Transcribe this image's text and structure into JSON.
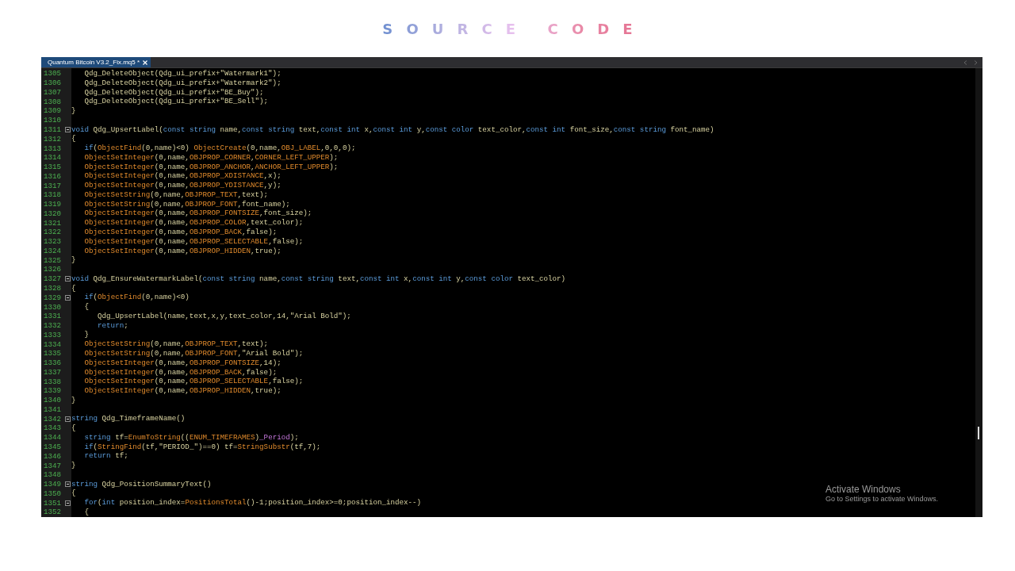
{
  "page_title": "SOURCE CODE",
  "editor": {
    "tabs": [
      {
        "label": "Quantum Bitcoin V3.2_Fix.mq5 *",
        "selected": true
      }
    ],
    "lines": [
      {
        "number": "1305",
        "foldable": false,
        "tokens": [
          {
            "kind": "plain",
            "text": "   Qdg_DeleteObject(Qdg_ui_prefix+\"Watermark1\");"
          }
        ]
      },
      {
        "number": "1306",
        "foldable": false,
        "tokens": [
          {
            "kind": "plain",
            "text": "   Qdg_DeleteObject(Qdg_ui_prefix+\"Watermark2\");"
          }
        ]
      },
      {
        "number": "1307",
        "foldable": false,
        "tokens": [
          {
            "kind": "plain",
            "text": "   Qdg_DeleteObject(Qdg_ui_prefix+\"BE_Buy\");"
          }
        ]
      },
      {
        "number": "1308",
        "foldable": false,
        "tokens": [
          {
            "kind": "plain",
            "text": "   Qdg_DeleteObject(Qdg_ui_prefix+\"BE_Sell\");"
          }
        ]
      },
      {
        "number": "1309",
        "foldable": false,
        "tokens": [
          {
            "kind": "plain",
            "text": "}"
          }
        ]
      },
      {
        "number": "1310",
        "foldable": false
      },
      {
        "number": "1311",
        "foldable": true,
        "tokens": [
          {
            "kind": "kw",
            "text": "void"
          },
          {
            "kind": "plain",
            "text": " Qdg_UpsertLabel("
          },
          {
            "kind": "kw",
            "text": "const string"
          },
          {
            "kind": "plain",
            "text": " name,"
          },
          {
            "kind": "kw",
            "text": "const string"
          },
          {
            "kind": "plain",
            "text": " text,"
          },
          {
            "kind": "kw",
            "text": "const int"
          },
          {
            "kind": "plain",
            "text": " x,"
          },
          {
            "kind": "kw",
            "text": "const int"
          },
          {
            "kind": "plain",
            "text": " y,"
          },
          {
            "kind": "kw",
            "text": "const color"
          },
          {
            "kind": "plain",
            "text": " text_color,"
          },
          {
            "kind": "kw",
            "text": "const int"
          },
          {
            "kind": "plain",
            "text": " font_size,"
          },
          {
            "kind": "kw",
            "text": "const string"
          },
          {
            "kind": "plain",
            "text": " font_name)"
          }
        ]
      },
      {
        "number": "1312",
        "foldable": false,
        "tokens": [
          {
            "kind": "plain",
            "text": "{"
          }
        ]
      },
      {
        "number": "1313",
        "foldable": false,
        "tokens": [
          {
            "kind": "kw",
            "text": "   if"
          },
          {
            "kind": "plain",
            "text": "("
          },
          {
            "kind": "fn",
            "text": "ObjectFind"
          },
          {
            "kind": "plain",
            "text": "(0,name)<0) "
          },
          {
            "kind": "fn",
            "text": "ObjectCreate"
          },
          {
            "kind": "plain",
            "text": "(0,name,"
          },
          {
            "kind": "fn",
            "text": "OBJ_LABEL"
          },
          {
            "kind": "plain",
            "text": ",0,0,0);"
          }
        ]
      },
      {
        "number": "1314",
        "foldable": false,
        "tokens": [
          {
            "kind": "fn",
            "text": "   ObjectSetInteger"
          },
          {
            "kind": "plain",
            "text": "(0,name,"
          },
          {
            "kind": "fn",
            "text": "OBJPROP_CORNER"
          },
          {
            "kind": "plain",
            "text": ","
          },
          {
            "kind": "fn",
            "text": "CORNER_LEFT_UPPER"
          },
          {
            "kind": "plain",
            "text": ");"
          }
        ]
      },
      {
        "number": "1315",
        "foldable": false,
        "tokens": [
          {
            "kind": "fn",
            "text": "   ObjectSetInteger"
          },
          {
            "kind": "plain",
            "text": "(0,name,"
          },
          {
            "kind": "fn",
            "text": "OBJPROP_ANCHOR"
          },
          {
            "kind": "plain",
            "text": ","
          },
          {
            "kind": "fn",
            "text": "ANCHOR_LEFT_UPPER"
          },
          {
            "kind": "plain",
            "text": ");"
          }
        ]
      },
      {
        "number": "1316",
        "foldable": false,
        "tokens": [
          {
            "kind": "fn",
            "text": "   ObjectSetInteger"
          },
          {
            "kind": "plain",
            "text": "(0,name,"
          },
          {
            "kind": "fn",
            "text": "OBJPROP_XDISTANCE"
          },
          {
            "kind": "plain",
            "text": ",x);"
          }
        ]
      },
      {
        "number": "1317",
        "foldable": false,
        "tokens": [
          {
            "kind": "fn",
            "text": "   ObjectSetInteger"
          },
          {
            "kind": "plain",
            "text": "(0,name,"
          },
          {
            "kind": "fn",
            "text": "OBJPROP_YDISTANCE"
          },
          {
            "kind": "plain",
            "text": ",y);"
          }
        ]
      },
      {
        "number": "1318",
        "foldable": false,
        "tokens": [
          {
            "kind": "fn",
            "text": "   ObjectSetString"
          },
          {
            "kind": "plain",
            "text": "(0,name,"
          },
          {
            "kind": "fn",
            "text": "OBJPROP_TEXT"
          },
          {
            "kind": "plain",
            "text": ",text);"
          }
        ]
      },
      {
        "number": "1319",
        "foldable": false,
        "tokens": [
          {
            "kind": "fn",
            "text": "   ObjectSetString"
          },
          {
            "kind": "plain",
            "text": "(0,name,"
          },
          {
            "kind": "fn",
            "text": "OBJPROP_FONT"
          },
          {
            "kind": "plain",
            "text": ",font_name);"
          }
        ]
      },
      {
        "number": "1320",
        "foldable": false,
        "tokens": [
          {
            "kind": "fn",
            "text": "   ObjectSetInteger"
          },
          {
            "kind": "plain",
            "text": "(0,name,"
          },
          {
            "kind": "fn",
            "text": "OBJPROP_FONTSIZE"
          },
          {
            "kind": "plain",
            "text": ",font_size);"
          }
        ]
      },
      {
        "number": "1321",
        "foldable": false,
        "tokens": [
          {
            "kind": "fn",
            "text": "   ObjectSetInteger"
          },
          {
            "kind": "plain",
            "text": "(0,name,"
          },
          {
            "kind": "fn",
            "text": "OBJPROP_COLOR"
          },
          {
            "kind": "plain",
            "text": ",text_color);"
          }
        ]
      },
      {
        "number": "1322",
        "foldable": false,
        "tokens": [
          {
            "kind": "fn",
            "text": "   ObjectSetInteger"
          },
          {
            "kind": "plain",
            "text": "(0,name,"
          },
          {
            "kind": "fn",
            "text": "OBJPROP_BACK"
          },
          {
            "kind": "plain",
            "text": ",false);"
          }
        ]
      },
      {
        "number": "1323",
        "foldable": false,
        "tokens": [
          {
            "kind": "fn",
            "text": "   ObjectSetInteger"
          },
          {
            "kind": "plain",
            "text": "(0,name,"
          },
          {
            "kind": "fn",
            "text": "OBJPROP_SELECTABLE"
          },
          {
            "kind": "plain",
            "text": ",false);"
          }
        ]
      },
      {
        "number": "1324",
        "foldable": false,
        "tokens": [
          {
            "kind": "fn",
            "text": "   ObjectSetInteger"
          },
          {
            "kind": "plain",
            "text": "(0,name,"
          },
          {
            "kind": "fn",
            "text": "OBJPROP_HIDDEN"
          },
          {
            "kind": "plain",
            "text": ",true);"
          }
        ]
      },
      {
        "number": "1325",
        "foldable": false,
        "tokens": [
          {
            "kind": "plain",
            "text": "}"
          }
        ]
      },
      {
        "number": "1326",
        "foldable": false
      },
      {
        "number": "1327",
        "foldable": true,
        "tokens": [
          {
            "kind": "kw",
            "text": "void"
          },
          {
            "kind": "plain",
            "text": " Qdg_EnsureWatermarkLabel("
          },
          {
            "kind": "kw",
            "text": "const string"
          },
          {
            "kind": "plain",
            "text": " name,"
          },
          {
            "kind": "kw",
            "text": "const string"
          },
          {
            "kind": "plain",
            "text": " text,"
          },
          {
            "kind": "kw",
            "text": "const int"
          },
          {
            "kind": "plain",
            "text": " x,"
          },
          {
            "kind": "kw",
            "text": "const int"
          },
          {
            "kind": "plain",
            "text": " y,"
          },
          {
            "kind": "kw",
            "text": "const color"
          },
          {
            "kind": "plain",
            "text": " text_color)"
          }
        ]
      },
      {
        "number": "1328",
        "foldable": false,
        "tokens": [
          {
            "kind": "plain",
            "text": "{"
          }
        ]
      },
      {
        "number": "1329",
        "foldable": true,
        "tokens": [
          {
            "kind": "kw",
            "text": "   if"
          },
          {
            "kind": "plain",
            "text": "("
          },
          {
            "kind": "fn",
            "text": "ObjectFind"
          },
          {
            "kind": "plain",
            "text": "(0,name)<0)"
          }
        ]
      },
      {
        "number": "1330",
        "foldable": false,
        "tokens": [
          {
            "kind": "plain",
            "text": "   {"
          }
        ]
      },
      {
        "number": "1331",
        "foldable": false,
        "tokens": [
          {
            "kind": "plain",
            "text": "      Qdg_UpsertLabel(name,text,x,y,text_color,14,\"Arial Bold\");"
          }
        ]
      },
      {
        "number": "1332",
        "foldable": false,
        "tokens": [
          {
            "kind": "kw",
            "text": "      return"
          },
          {
            "kind": "plain",
            "text": ";"
          }
        ]
      },
      {
        "number": "1333",
        "foldable": false,
        "tokens": [
          {
            "kind": "plain",
            "text": "   }"
          }
        ]
      },
      {
        "number": "1334",
        "foldable": false,
        "tokens": [
          {
            "kind": "fn",
            "text": "   ObjectSetString"
          },
          {
            "kind": "plain",
            "text": "(0,name,"
          },
          {
            "kind": "fn",
            "text": "OBJPROP_TEXT"
          },
          {
            "kind": "plain",
            "text": ",text);"
          }
        ]
      },
      {
        "number": "1335",
        "foldable": false,
        "tokens": [
          {
            "kind": "fn",
            "text": "   ObjectSetString"
          },
          {
            "kind": "plain",
            "text": "(0,name,"
          },
          {
            "kind": "fn",
            "text": "OBJPROP_FONT"
          },
          {
            "kind": "plain",
            "text": ",\"Arial Bold\");"
          }
        ]
      },
      {
        "number": "1336",
        "foldable": false,
        "tokens": [
          {
            "kind": "fn",
            "text": "   ObjectSetInteger"
          },
          {
            "kind": "plain",
            "text": "(0,name,"
          },
          {
            "kind": "fn",
            "text": "OBJPROP_FONTSIZE"
          },
          {
            "kind": "plain",
            "text": ",14);"
          }
        ]
      },
      {
        "number": "1337",
        "foldable": false,
        "tokens": [
          {
            "kind": "fn",
            "text": "   ObjectSetInteger"
          },
          {
            "kind": "plain",
            "text": "(0,name,"
          },
          {
            "kind": "fn",
            "text": "OBJPROP_BACK"
          },
          {
            "kind": "plain",
            "text": ",false);"
          }
        ]
      },
      {
        "number": "1338",
        "foldable": false,
        "tokens": [
          {
            "kind": "fn",
            "text": "   ObjectSetInteger"
          },
          {
            "kind": "plain",
            "text": "(0,name,"
          },
          {
            "kind": "fn",
            "text": "OBJPROP_SELECTABLE"
          },
          {
            "kind": "plain",
            "text": ",false);"
          }
        ]
      },
      {
        "number": "1339",
        "foldable": false,
        "tokens": [
          {
            "kind": "fn",
            "text": "   ObjectSetInteger"
          },
          {
            "kind": "plain",
            "text": "(0,name,"
          },
          {
            "kind": "fn",
            "text": "OBJPROP_HIDDEN"
          },
          {
            "kind": "plain",
            "text": ",true);"
          }
        ]
      },
      {
        "number": "1340",
        "foldable": false,
        "tokens": [
          {
            "kind": "plain",
            "text": "}"
          }
        ]
      },
      {
        "number": "1341",
        "foldable": false
      },
      {
        "number": "1342",
        "foldable": true,
        "tokens": [
          {
            "kind": "kw",
            "text": "string"
          },
          {
            "kind": "plain",
            "text": " Qdg_TimeframeName()"
          }
        ]
      },
      {
        "number": "1343",
        "foldable": false,
        "tokens": [
          {
            "kind": "plain",
            "text": "{"
          }
        ]
      },
      {
        "number": "1344",
        "foldable": false,
        "tokens": [
          {
            "kind": "kw",
            "text": "   string"
          },
          {
            "kind": "plain",
            "text": " tf="
          },
          {
            "kind": "fn",
            "text": "EnumToString"
          },
          {
            "kind": "plain",
            "text": "(("
          },
          {
            "kind": "fn",
            "text": "ENUM_TIMEFRAMES"
          },
          {
            "kind": "plain",
            "text": ")"
          },
          {
            "kind": "var",
            "text": "_Period"
          },
          {
            "kind": "plain",
            "text": ");"
          }
        ]
      },
      {
        "number": "1345",
        "foldable": false,
        "tokens": [
          {
            "kind": "kw",
            "text": "   if"
          },
          {
            "kind": "plain",
            "text": "("
          },
          {
            "kind": "fn",
            "text": "StringFind"
          },
          {
            "kind": "plain",
            "text": "(tf,\"PERIOD_\")==0) tf="
          },
          {
            "kind": "fn",
            "text": "StringSubstr"
          },
          {
            "kind": "plain",
            "text": "(tf,7);"
          }
        ]
      },
      {
        "number": "1346",
        "foldable": false,
        "tokens": [
          {
            "kind": "kw",
            "text": "   return"
          },
          {
            "kind": "plain",
            "text": " tf;"
          }
        ]
      },
      {
        "number": "1347",
        "foldable": false,
        "tokens": [
          {
            "kind": "plain",
            "text": "}"
          }
        ]
      },
      {
        "number": "1348",
        "foldable": false
      },
      {
        "number": "1349",
        "foldable": true,
        "tokens": [
          {
            "kind": "kw",
            "text": "string"
          },
          {
            "kind": "plain",
            "text": " Qdg_PositionSummaryText()"
          }
        ]
      },
      {
        "number": "1350",
        "foldable": false,
        "tokens": [
          {
            "kind": "plain",
            "text": "{"
          }
        ]
      },
      {
        "number": "1351",
        "foldable": true,
        "tokens": [
          {
            "kind": "kw",
            "text": "   for"
          },
          {
            "kind": "plain",
            "text": "("
          },
          {
            "kind": "kw",
            "text": "int"
          },
          {
            "kind": "plain",
            "text": " position_index="
          },
          {
            "kind": "fn",
            "text": "PositionsTotal"
          },
          {
            "kind": "plain",
            "text": "()-1;position_index>=0;position_index--)"
          }
        ]
      },
      {
        "number": "1352",
        "foldable": false,
        "tokens": [
          {
            "kind": "plain",
            "text": "   {"
          }
        ]
      }
    ]
  },
  "os_notice": {
    "title": "Activate Windows",
    "subtitle": "Go to Settings to activate Windows."
  }
}
